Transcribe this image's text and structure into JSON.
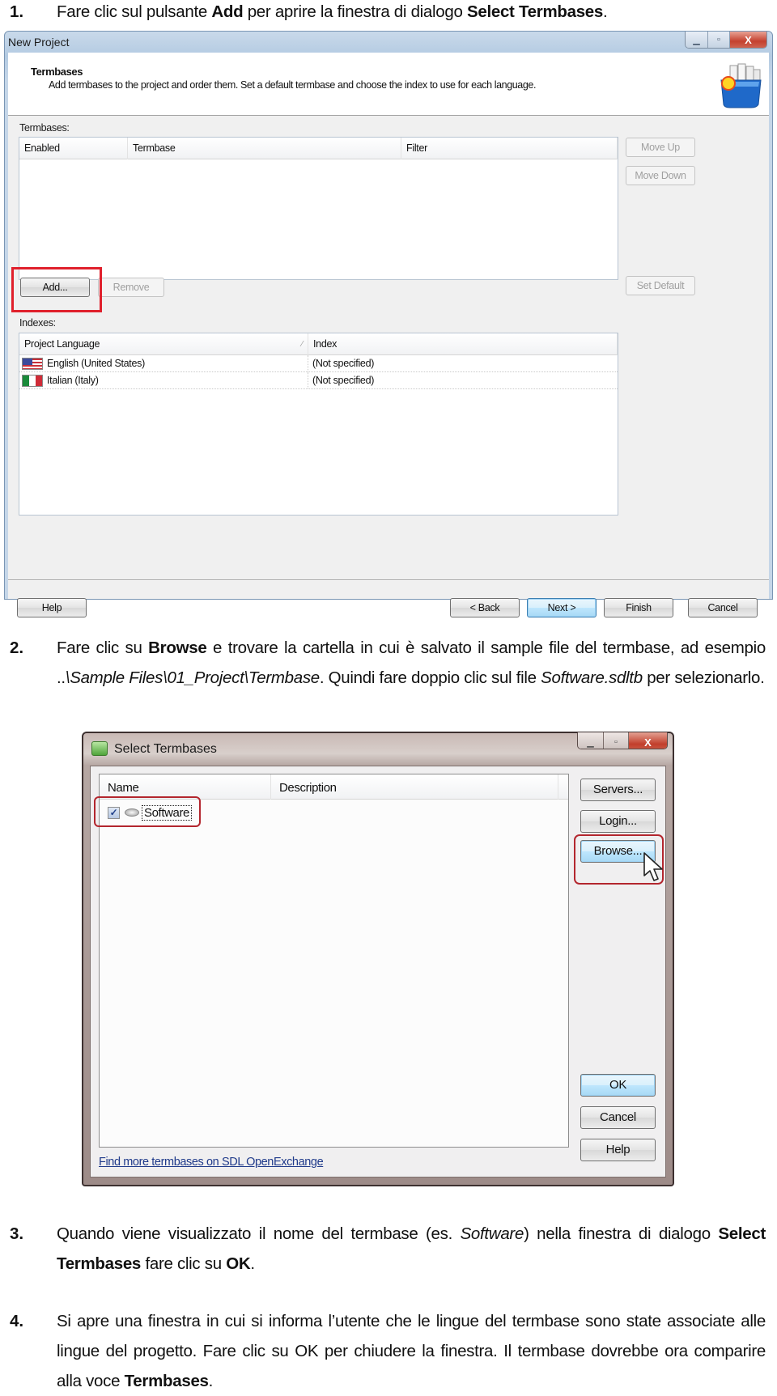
{
  "steps": [
    {
      "number": "1.",
      "parts": [
        {
          "t": "Fare clic sul pulsante "
        },
        {
          "t": "Add",
          "b": true
        },
        {
          "t": " per aprire la finestra di dialogo "
        },
        {
          "t": "Select Termbases",
          "b": true
        },
        {
          "t": "."
        }
      ]
    },
    {
      "number": "2.",
      "parts": [
        {
          "t": "Fare clic su "
        },
        {
          "t": "Browse",
          "b": true
        },
        {
          "t": " e trovare la cartella in cui è salvato il sample file del termbase, ad esempio .."
        },
        {
          "t": "\\Sample Files\\01_Project\\Termbase",
          "i": true
        },
        {
          "t": ". Quindi fare doppio clic sul file "
        },
        {
          "t": "Software.sdltb",
          "i": true
        },
        {
          "t": " per selezionarlo."
        }
      ]
    },
    {
      "number": "3.",
      "parts": [
        {
          "t": "Quando viene visualizzato il nome del termbase (es. "
        },
        {
          "t": "Software",
          "i": true
        },
        {
          "t": ") nella finestra di dialogo "
        },
        {
          "t": "Select Termbases",
          "b": true
        },
        {
          "t": " fare clic su "
        },
        {
          "t": "OK",
          "b": true
        },
        {
          "t": "."
        }
      ]
    },
    {
      "number": "4.",
      "parts": [
        {
          "t": "Si  apre una finestra in cui si informa l’utente che le lingue del termbase sono state associate alle lingue del progetto. Fare clic su OK per chiudere la finestra. Il termbase dovrebbe ora comparire alla voce "
        },
        {
          "t": "Termbases",
          "b": true
        },
        {
          "t": "."
        }
      ]
    }
  ],
  "new_project": {
    "title": "New Project",
    "window_buttons": {
      "minimize": "▁",
      "maximize": "▫",
      "close": "X"
    },
    "header_title": "Termbases",
    "header_subtitle": "Add termbases to the project and order them. Set a default termbase and choose the index to use for each language.",
    "header_icon": "termbase-bucket-icon",
    "termbases_label": "Termbases:",
    "termbases_columns": [
      "Enabled",
      "Termbase",
      "Filter"
    ],
    "side_buttons": {
      "move_up": "Move Up",
      "move_down": "Move Down",
      "set_default": "Set Default"
    },
    "add_button": "Add...",
    "remove_button": "Remove",
    "indexes_label": "Indexes:",
    "indexes_columns": [
      "Project Language",
      "Index"
    ],
    "indexes_rows": [
      {
        "flag": "us-flag-icon",
        "language": "English (United States)",
        "index": "(Not specified)"
      },
      {
        "flag": "italy-flag-icon",
        "language": "Italian (Italy)",
        "index": "(Not specified)"
      }
    ],
    "footer_buttons": {
      "help": "Help",
      "back": "< Back",
      "next": "Next >",
      "finish": "Finish",
      "cancel": "Cancel"
    },
    "highlight_color": "#e0202c"
  },
  "select_termbases": {
    "title": "Select Termbases",
    "window_buttons": {
      "minimize": "▁",
      "maximize": "▫",
      "close": "X"
    },
    "columns": [
      "Name",
      "Description"
    ],
    "rows": [
      {
        "checked": true,
        "check_mark": "✓",
        "name": "Software"
      }
    ],
    "buttons": {
      "servers": "Servers...",
      "login": "Login...",
      "browse": "Browse...",
      "ok": "OK",
      "cancel": "Cancel",
      "help": "Help"
    },
    "link": "Find more termbases on SDL OpenExchange",
    "highlight_color": "#b3262e"
  }
}
